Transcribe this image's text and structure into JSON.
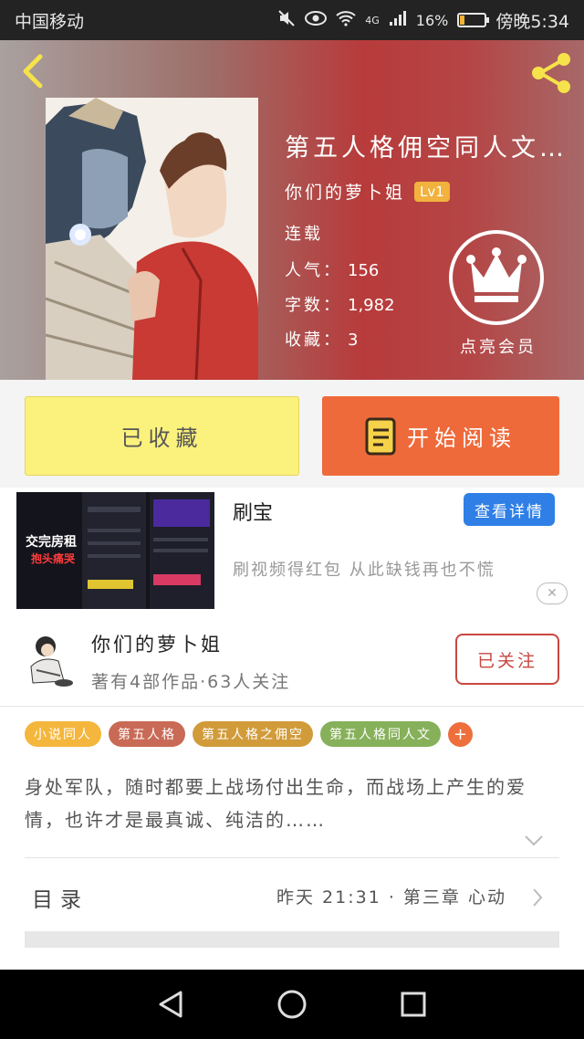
{
  "status_bar": {
    "carrier": "中国移动",
    "signal": "4G",
    "battery_percent": "16%",
    "battery_level": 0.16,
    "time": "傍晚5:34",
    "icons": [
      "mute-icon",
      "eye-icon",
      "wifi-icon",
      "signal-icon",
      "battery-icon"
    ]
  },
  "header": {
    "title": "第五人格佣空同人文…",
    "author": "你们的萝卜姐",
    "level_badge": "Lv1",
    "status": "连载",
    "popularity_label": "人气：",
    "popularity_value": "156",
    "words_label": "字数：",
    "words_value": "1,982",
    "favorites_label": "收藏：",
    "favorites_value": "3",
    "vip_label": "点亮会员"
  },
  "actions": {
    "collected_label": "已收藏",
    "read_label": "开始阅读"
  },
  "ad": {
    "title": "刷宝",
    "detail_button": "查看详情",
    "description": "刷视频得红包 从此缺钱再也不慌",
    "close": "✕",
    "thumb_text_1": "交完房租",
    "thumb_text_2": "抱头痛哭"
  },
  "author": {
    "name": "你们的萝卜姐",
    "stats": "著有4部作品·63人关注",
    "follow_label": "已关注"
  },
  "tags": [
    {
      "label": "小说同人",
      "color": "#f4b63c"
    },
    {
      "label": "第五人格",
      "color": "#c96a56"
    },
    {
      "label": "第五人格之佣空",
      "color": "#d19b3a"
    },
    {
      "label": "第五人格同人文",
      "color": "#86b05a"
    }
  ],
  "tag_add": "+",
  "description": "身处军队，随时都要上战场付出生命，而战场上产生的爱情，也许才是最真诚、纯洁的……",
  "toc": {
    "label": "目录",
    "update": "昨天 21:31 · 第三章 心动"
  },
  "colors": {
    "accent_orange": "#ef6a3a",
    "collected_yellow": "#fbf27d",
    "follow_red": "#c8473f",
    "detail_blue": "#2f7fe6"
  }
}
